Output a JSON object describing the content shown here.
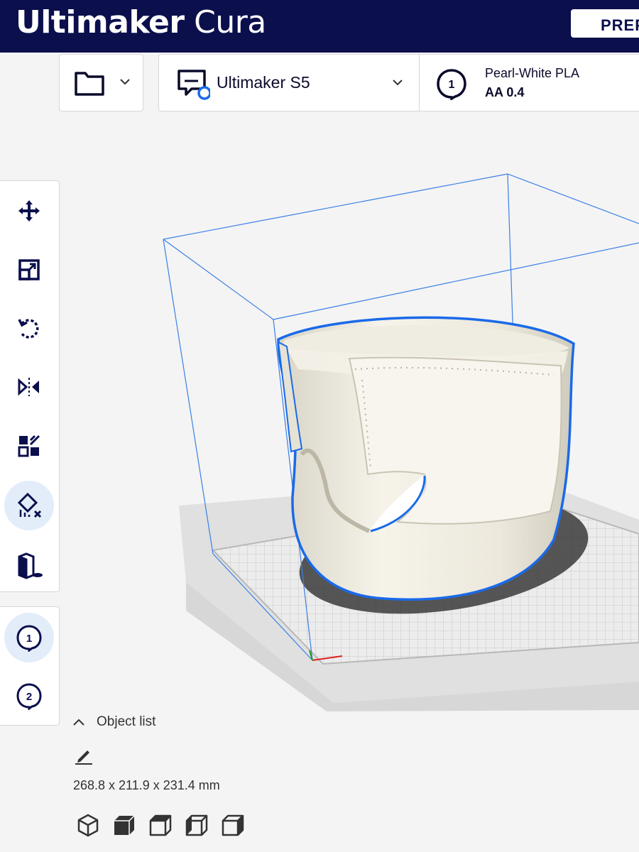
{
  "app": {
    "brand_bold": "Ultimaker",
    "brand_light": "Cura"
  },
  "header": {
    "active_stage_tab": "PREP"
  },
  "printer": {
    "name": "Ultimaker S5"
  },
  "extruder": {
    "number": "1",
    "material": "Pearl-White PLA",
    "nozzle": "AA 0.4"
  },
  "tools": [
    {
      "icon": "move-icon"
    },
    {
      "icon": "scale-icon"
    },
    {
      "icon": "rotate-icon"
    },
    {
      "icon": "mirror-icon"
    },
    {
      "icon": "per-model-settings-icon"
    },
    {
      "icon": "support-blocker-icon",
      "active": true
    },
    {
      "icon": "object-placement-icon"
    }
  ],
  "extruders": [
    {
      "label": "1",
      "active": true
    },
    {
      "label": "2",
      "active": false
    }
  ],
  "object_list": {
    "label": "Object list",
    "dimensions": "268.8 x 211.9 x 231.4 mm"
  },
  "view_buttons": [
    "3d-view-icon",
    "front-view-icon",
    "top-view-icon",
    "left-view-icon",
    "right-view-icon"
  ],
  "colors": {
    "header": "#0b0f4c",
    "accent": "#1a6ae8",
    "active_tool_bg": "#e3edfa",
    "model": "#f2efe4"
  }
}
